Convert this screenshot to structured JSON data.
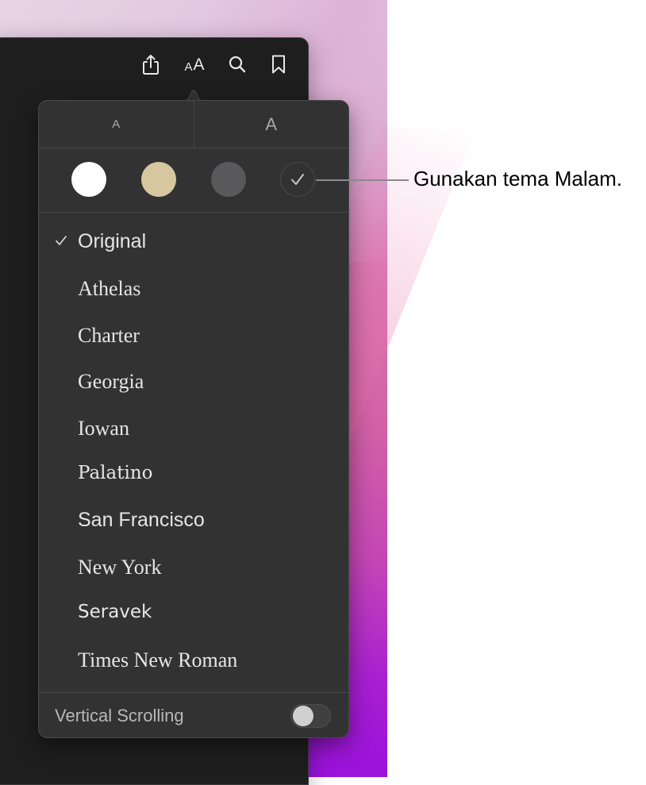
{
  "toolbar": {
    "buttons": [
      {
        "name": "share",
        "icon": "share-icon"
      },
      {
        "name": "appearance",
        "icon": "text-size-icon",
        "small_glyph": "A",
        "large_glyph": "A"
      },
      {
        "name": "search",
        "icon": "search-icon"
      },
      {
        "name": "bookmark",
        "icon": "bookmark-icon"
      }
    ]
  },
  "popover": {
    "font_size": {
      "decrease_label": "A",
      "increase_label": "A"
    },
    "themes": [
      {
        "name": "White",
        "color": "#ffffff",
        "selected": false
      },
      {
        "name": "Sepia",
        "color": "#d7c7a0",
        "selected": false
      },
      {
        "name": "Gray",
        "color": "#59595b",
        "selected": false
      },
      {
        "name": "Night",
        "color": "#323232",
        "selected": true
      }
    ],
    "fonts": [
      {
        "label": "Original",
        "selected": true
      },
      {
        "label": "Athelas",
        "selected": false
      },
      {
        "label": "Charter",
        "selected": false
      },
      {
        "label": "Georgia",
        "selected": false
      },
      {
        "label": "Iowan",
        "selected": false
      },
      {
        "label": "Palatino",
        "selected": false
      },
      {
        "label": "San Francisco",
        "selected": false
      },
      {
        "label": "New York",
        "selected": false
      },
      {
        "label": "Seravek",
        "selected": false
      },
      {
        "label": "Times New Roman",
        "selected": false
      }
    ],
    "vertical_scrolling": {
      "label": "Vertical Scrolling",
      "enabled": false
    }
  },
  "callout": {
    "text": "Gunakan tema Malam."
  }
}
